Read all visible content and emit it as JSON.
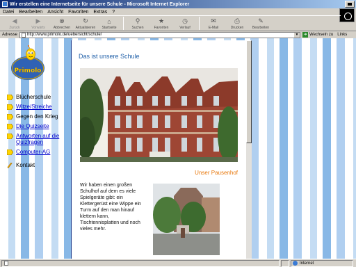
{
  "window": {
    "title": "Wir erstellen eine Internetseite für unsere Schule - Microsoft Internet Explorer"
  },
  "menu": [
    "Datei",
    "Bearbeiten",
    "Ansicht",
    "Favoriten",
    "Extras",
    "?"
  ],
  "toolbar": [
    {
      "label": "Zurück",
      "icon": "back-arrow-icon",
      "enabled": false
    },
    {
      "label": "Vorwärts",
      "icon": "forward-arrow-icon",
      "enabled": false
    },
    {
      "label": "Abbrechen",
      "icon": "stop-icon",
      "enabled": true
    },
    {
      "label": "Aktualisieren",
      "icon": "refresh-icon",
      "enabled": true
    },
    {
      "label": "Startseite",
      "icon": "home-icon",
      "enabled": true
    },
    {
      "label": "Suchen",
      "icon": "search-icon",
      "enabled": true
    },
    {
      "label": "Favoriten",
      "icon": "favorites-icon",
      "enabled": true
    },
    {
      "label": "Verlauf",
      "icon": "history-icon",
      "enabled": true
    },
    {
      "label": "E-Mail",
      "icon": "mail-icon",
      "enabled": true
    },
    {
      "label": "Drucken",
      "icon": "print-icon",
      "enabled": true
    },
    {
      "label": "Bearbeiten",
      "icon": "edit-icon",
      "enabled": true
    }
  ],
  "address": {
    "label": "Adresse",
    "url": "http://www.primolo.de/uebersicht/schule/",
    "go_label": "Wechseln zu",
    "links_label": "Links"
  },
  "sidebar": {
    "logo_text": "Primolo",
    "nav": [
      {
        "label": "Blücherschule",
        "link": false
      },
      {
        "label": "Witze/Streiche",
        "link": true
      },
      {
        "label": "Gegen den Krieg",
        "link": false
      },
      {
        "label": "Die Quizseite",
        "link": true
      },
      {
        "label": "Antworten auf die Quizfragen",
        "link": true
      },
      {
        "label": "Computer-AG",
        "link": true
      }
    ],
    "contact_label": "Kontakt"
  },
  "content": {
    "title": "Das ist unsere Schule",
    "caption": "Unser Pausenhof",
    "paragraph": "Wir haben einen großen Schulhof auf dem es viele Spielgeräte gibt: ein Klettergerüst eine Wippe ein Turm auf den man hinauf klettern kann, Tischtennisplatten und noch vieles mehr."
  },
  "status": {
    "text": "",
    "zone": "Internet"
  },
  "colors": {
    "title_blue": "#1f5fa8",
    "caption_orange": "#e8770a",
    "link_blue": "#0000cc",
    "titlebar_start": "#0a246a"
  }
}
